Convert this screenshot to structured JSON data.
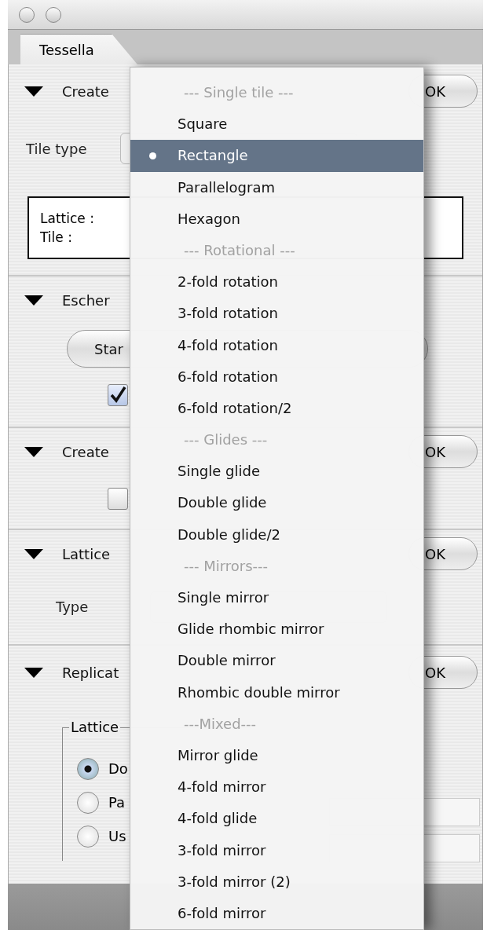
{
  "window": {
    "tab": {
      "label": "Tessella",
      "selected": true
    }
  },
  "sections": [
    {
      "title": "Create",
      "expanded": true,
      "ok_button": "OK",
      "rows": [
        {
          "kind": "label",
          "text": "Tile type"
        },
        {
          "kind": "info",
          "lines": [
            "Lattice :",
            "Tile :"
          ]
        }
      ]
    },
    {
      "title": "Escher",
      "expanded": true,
      "rows": [
        {
          "kind": "button",
          "text": "Star"
        },
        {
          "kind": "checkbox",
          "checked": true
        }
      ]
    },
    {
      "title": "Create",
      "expanded": true,
      "ok_button": "OK",
      "rows": [
        {
          "kind": "checkbox",
          "checked": false
        }
      ]
    },
    {
      "title": "Lattice",
      "expanded": true,
      "ok_button": "OK",
      "rows": [
        {
          "kind": "label",
          "text": "Type"
        }
      ]
    },
    {
      "title": "Replicat",
      "expanded": true,
      "ok_button": "OK",
      "rows": [
        {
          "kind": "radio_group",
          "legend": "Lattice",
          "options": [
            {
              "label": "Do",
              "selected": true
            },
            {
              "label": "Pa",
              "selected": false
            },
            {
              "label": "Us",
              "selected": false
            }
          ]
        }
      ]
    }
  ],
  "menu": [
    {
      "kind": "header",
      "text": "--- Single tile ---"
    },
    {
      "kind": "item",
      "text": "Square",
      "selected": false
    },
    {
      "kind": "item",
      "text": "Rectangle",
      "selected": true
    },
    {
      "kind": "item",
      "text": "Parallelogram",
      "selected": false
    },
    {
      "kind": "item",
      "text": "Hexagon",
      "selected": false
    },
    {
      "kind": "header",
      "text": "--- Rotational ---"
    },
    {
      "kind": "item",
      "text": "2-fold rotation",
      "selected": false
    },
    {
      "kind": "item",
      "text": "3-fold rotation",
      "selected": false
    },
    {
      "kind": "item",
      "text": "4-fold rotation",
      "selected": false
    },
    {
      "kind": "item",
      "text": "6-fold rotation",
      "selected": false
    },
    {
      "kind": "item",
      "text": "6-fold rotation/2",
      "selected": false
    },
    {
      "kind": "header",
      "text": "--- Glides ---"
    },
    {
      "kind": "item",
      "text": "Single glide",
      "selected": false
    },
    {
      "kind": "item",
      "text": "Double glide",
      "selected": false
    },
    {
      "kind": "item",
      "text": "Double glide/2",
      "selected": false
    },
    {
      "kind": "header",
      "text": "--- Mirrors---"
    },
    {
      "kind": "item",
      "text": "Single mirror",
      "selected": false
    },
    {
      "kind": "item",
      "text": "Glide rhombic mirror",
      "selected": false
    },
    {
      "kind": "item",
      "text": "Double mirror",
      "selected": false
    },
    {
      "kind": "item",
      "text": "Rhombic double mirror",
      "selected": false
    },
    {
      "kind": "header",
      "text": "---Mixed---"
    },
    {
      "kind": "item",
      "text": "Mirror glide",
      "selected": false
    },
    {
      "kind": "item",
      "text": "4-fold mirror",
      "selected": false
    },
    {
      "kind": "item",
      "text": "4-fold glide",
      "selected": false
    },
    {
      "kind": "item",
      "text": "3-fold mirror",
      "selected": false
    },
    {
      "kind": "item",
      "text": "3-fold mirror (2)",
      "selected": false
    },
    {
      "kind": "item",
      "text": "6-fold mirror",
      "selected": false
    }
  ]
}
